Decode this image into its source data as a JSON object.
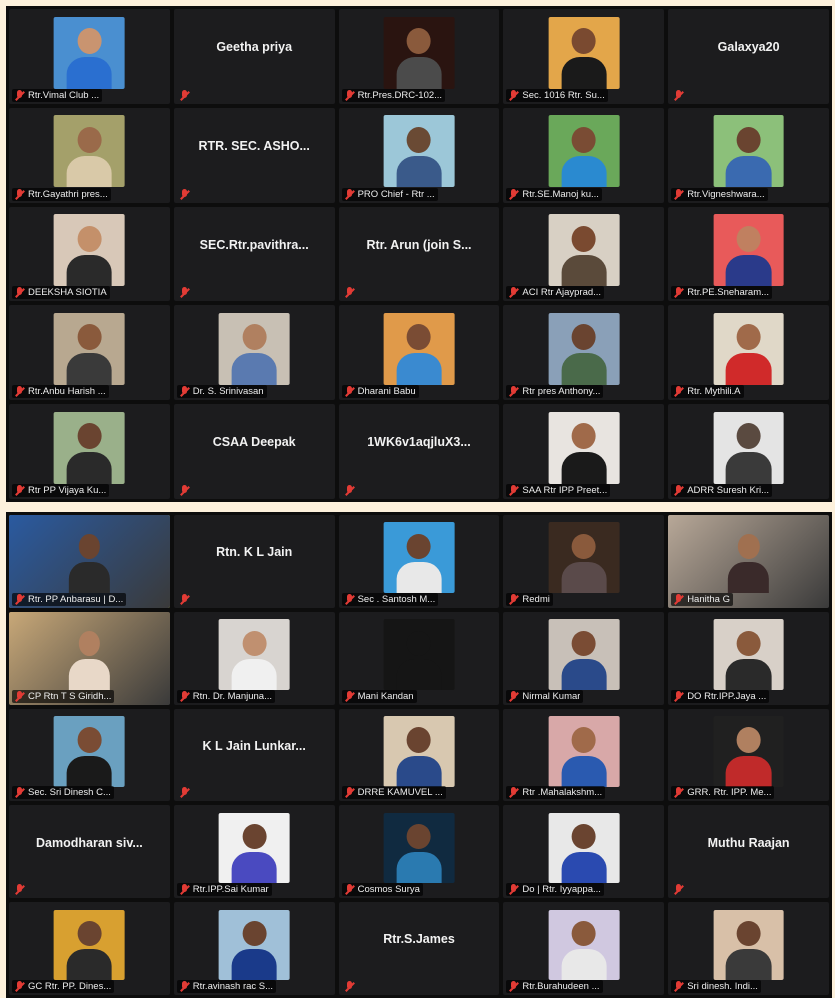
{
  "screens": [
    {
      "tiles": [
        {
          "big": "",
          "caption": "Rtr.Vimal Club ...",
          "photo": "#4a8fd0",
          "skin": "#c99470",
          "shirt": "#2a6fd0"
        },
        {
          "big": "Geetha priya",
          "caption": ""
        },
        {
          "big": "",
          "caption": "Rtr.Pres.DRC-102...",
          "photo": "#2a1410",
          "skin": "#8a5a3c",
          "shirt": "#4b4b4b"
        },
        {
          "big": "",
          "caption": "Sec. 1016 Rtr. Su...",
          "photo": "#e3a64a",
          "skin": "#7a4a30",
          "shirt": "#1a1a1a"
        },
        {
          "big": "Galaxya20",
          "caption": ""
        },
        {
          "big": "",
          "caption": "Rtr.Gayathri pres...",
          "photo": "#a4a06a",
          "skin": "#9a6a4a",
          "shirt": "#d9c9a8"
        },
        {
          "big": "RTR. SEC. ASHO...",
          "caption": ""
        },
        {
          "big": "",
          "caption": "PRO Chief - Rtr ...",
          "photo": "#9cc7d8",
          "skin": "#6a4a34",
          "shirt": "#3a5a8a"
        },
        {
          "big": "",
          "caption": "Rtr.SE.Manoj ku...",
          "photo": "#6aa85a",
          "skin": "#7a4c34",
          "shirt": "#2a8ad0"
        },
        {
          "big": "",
          "caption": "Rtr.Vigneshwara...",
          "photo": "#8cc07a",
          "skin": "#6a4430",
          "shirt": "#3a6ab0"
        },
        {
          "big": "",
          "caption": "DEEKSHA SIOTIA",
          "photo": "#d8c8b8",
          "skin": "#c4906a",
          "shirt": "#2a2a2a"
        },
        {
          "big": "SEC.Rtr.pavithra...",
          "caption": ""
        },
        {
          "big": "Rtr. Arun (join S...",
          "caption": ""
        },
        {
          "big": "",
          "caption": "ACI Rtr Ajayprad...",
          "photo": "#d8d0c4",
          "skin": "#7a4a30",
          "shirt": "#5a4a3a"
        },
        {
          "big": "",
          "caption": "Rtr.PE.Sneharam...",
          "photo": "#e85a5a",
          "skin": "#c08060",
          "shirt": "#2a3a8a"
        },
        {
          "big": "",
          "caption": "Rtr.Anbu Harish ...",
          "photo": "#b8a890",
          "skin": "#8a5a3c",
          "shirt": "#3a3a3a"
        },
        {
          "big": "",
          "caption": "Dr. S. Srinivasan",
          "photo": "#c8c0b4",
          "skin": "#b08060",
          "shirt": "#5a7ab0"
        },
        {
          "big": "",
          "caption": "Dharani Babu",
          "photo": "#e09a4a",
          "skin": "#7a4c34",
          "shirt": "#3a8ad0"
        },
        {
          "big": "",
          "caption": "Rtr pres Anthony...",
          "photo": "#8aa0b8",
          "skin": "#6a4430",
          "shirt": "#4a6a4a"
        },
        {
          "big": "",
          "caption": "Rtr. Mythili.A",
          "photo": "#e0d8c8",
          "skin": "#a06a4a",
          "shirt": "#d02a2a"
        },
        {
          "big": "",
          "caption": "Rtr PP Vijaya Ku...",
          "photo": "#9ab08a",
          "skin": "#6a4430",
          "shirt": "#2a2a2a"
        },
        {
          "big": "CSAA Deepak",
          "caption": ""
        },
        {
          "big": "1WK6v1aqjluX3...",
          "caption": ""
        },
        {
          "big": "",
          "caption": "SAA Rtr IPP Preet...",
          "photo": "#e8e4e0",
          "skin": "#a06a4a",
          "shirt": "#1a1a1a"
        },
        {
          "big": "",
          "caption": "ADRR Suresh Kri...",
          "photo": "#e4e4e4",
          "skin": "#5a4a40",
          "shirt": "#3a3a3a"
        }
      ]
    },
    {
      "tiles": [
        {
          "big": "",
          "caption": "Rtr. PP Anbarasu | D...",
          "video": "#2a5aa0",
          "skin": "#6a4430",
          "shirt": "#2a2a2a",
          "active": true
        },
        {
          "big": "Rtn. K L Jain",
          "caption": ""
        },
        {
          "big": "",
          "caption": "Sec . Santosh M...",
          "photo": "#3a9ad8",
          "skin": "#6a4430",
          "shirt": "#e8e8e8"
        },
        {
          "big": "",
          "caption": "Redmi",
          "photo": "#3a2a20",
          "skin": "#8a5a3c",
          "shirt": "#5a4a4a"
        },
        {
          "big": "",
          "caption": "Hanitha G",
          "video": "#b8a898",
          "skin": "#a07050",
          "shirt": "#3a2a2a"
        },
        {
          "big": "",
          "caption": "CP Rtn T S Giridh...",
          "video": "#c8a878",
          "skin": "#b08060",
          "shirt": "#e8d8c8"
        },
        {
          "big": "",
          "caption": "Rtn. Dr. Manjuna...",
          "photo": "#d8d4d0",
          "skin": "#c09070",
          "shirt": "#f0f0f0"
        },
        {
          "big": "",
          "caption": "Mani Kandan",
          "photo": "#151515",
          "skin": "#151515",
          "shirt": "#151515"
        },
        {
          "big": "",
          "caption": "Nirmal Kumar",
          "photo": "#c8c0b8",
          "skin": "#7a4c34",
          "shirt": "#2a4a8a"
        },
        {
          "big": "",
          "caption": "DO Rtr.IPP.Jaya ...",
          "photo": "#d8d0c8",
          "skin": "#8a5a3c",
          "shirt": "#2a2a2a"
        },
        {
          "big": "",
          "caption": "Sec. Sri Dinesh C...",
          "photo": "#6aa0c0",
          "skin": "#7a4c34",
          "shirt": "#1a1a1a"
        },
        {
          "big": "K L Jain Lunkar...",
          "caption": ""
        },
        {
          "big": "",
          "caption": "DRRE KAMUVEL ...",
          "photo": "#d8c8b0",
          "skin": "#6a4430",
          "shirt": "#2a4a8a"
        },
        {
          "big": "",
          "caption": "Rtr .Mahalakshm...",
          "photo": "#d8a8a8",
          "skin": "#a06a4a",
          "shirt": "#2a5ab0"
        },
        {
          "big": "",
          "caption": "GRR. Rtr. IPP. Me...",
          "photo": "#202020",
          "skin": "#b08060",
          "shirt": "#c02a2a"
        },
        {
          "big": "Damodharan siv...",
          "caption": ""
        },
        {
          "big": "",
          "caption": "Rtr.IPP.Sai Kumar",
          "photo": "#f0f0f0",
          "skin": "#6a4430",
          "shirt": "#4a4ac0"
        },
        {
          "big": "",
          "caption": "Cosmos Surya",
          "photo": "#102a40",
          "skin": "#6a4430",
          "shirt": "#2a7ab0"
        },
        {
          "big": "",
          "caption": "Do | Rtr. Iyyappa...",
          "photo": "#e8e8e8",
          "skin": "#6a4430",
          "shirt": "#2a4ab0"
        },
        {
          "big": "Muthu Raajan",
          "caption": ""
        },
        {
          "big": "",
          "caption": "GC Rtr. PP. Dines...",
          "photo": "#d8a030",
          "skin": "#6a4430",
          "shirt": "#2a2a2a"
        },
        {
          "big": "",
          "caption": "Rtr.avinash rac S...",
          "photo": "#a0c0d8",
          "skin": "#6a4430",
          "shirt": "#1a3a8a"
        },
        {
          "big": "Rtr.S.James",
          "caption": ""
        },
        {
          "big": "",
          "caption": "Rtr.Burahudeen ...",
          "photo": "#d0c8e0",
          "skin": "#8a5a3c",
          "shirt": "#e8e8e8"
        },
        {
          "big": "",
          "caption": "Sri dinesh. Indi...",
          "photo": "#d8c0a8",
          "skin": "#6a4430",
          "shirt": "#3a3a3a"
        }
      ]
    }
  ],
  "icons": {
    "muted": "mic-muted-icon"
  },
  "colors": {
    "muted_red": "#e23b35",
    "active_border": "#d6e34a",
    "tile_bg": "#1c1c1e"
  }
}
